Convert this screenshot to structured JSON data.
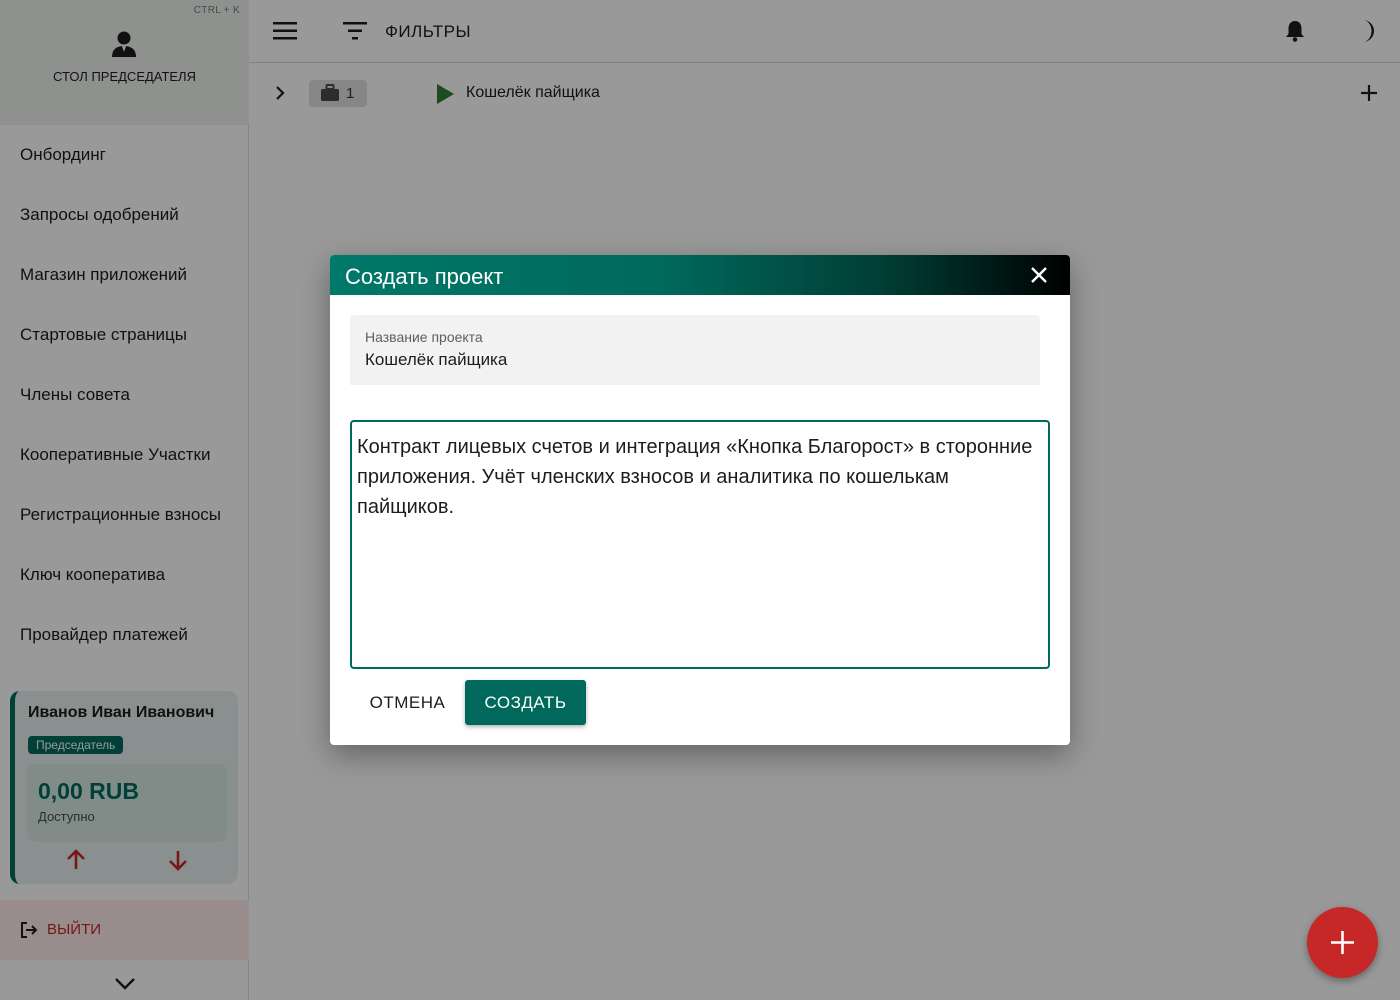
{
  "sidebar": {
    "shortcut": "CTRL + K",
    "title": "СТОЛ ПРЕДСЕДАТЕЛЯ",
    "items": [
      {
        "label": "Онбординг"
      },
      {
        "label": "Запросы одобрений"
      },
      {
        "label": "Магазин приложений"
      },
      {
        "label": "Стартовые страницы"
      },
      {
        "label": "Члены совета"
      },
      {
        "label": "Кооперативные Участки"
      },
      {
        "label": "Регистрационные взносы"
      },
      {
        "label": "Ключ кооператива"
      },
      {
        "label": "Провайдер платежей"
      }
    ],
    "user": {
      "name": "Иванов Иван Иванович",
      "role": "Председатель",
      "balance": "0,00 RUB",
      "balance_caption": "Доступно"
    },
    "logout_label": "ВЫЙТИ"
  },
  "topbar": {
    "filters_label": "ФИЛЬТРЫ"
  },
  "project_row": {
    "count": "1",
    "name": "Кошелёк пайщика"
  },
  "dialog": {
    "title": "Создать проект",
    "name_label": "Название проекта",
    "name_value": "Кошелёк пайщика",
    "description": "Контракт лицевых счетов и интеграция «Кнопка Благорост» в сторонние приложения. Учёт членских взносов и аналитика по кошелькам пайщиков.",
    "cancel_label": "ОТМЕНА",
    "create_label": "СОЗДАТЬ"
  },
  "colors": {
    "primary": "#00695c",
    "accent_red": "#c62828",
    "overlay": "rgba(0,0,0,0.40)"
  },
  "icons": [
    "person-icon",
    "menu-icon",
    "filter-icon",
    "bell-icon",
    "moon-icon",
    "chevron-right-icon",
    "briefcase-icon",
    "play-icon",
    "plus-icon",
    "arrow-up-icon",
    "arrow-down-icon",
    "logout-icon",
    "chevron-down-icon",
    "close-icon"
  ]
}
